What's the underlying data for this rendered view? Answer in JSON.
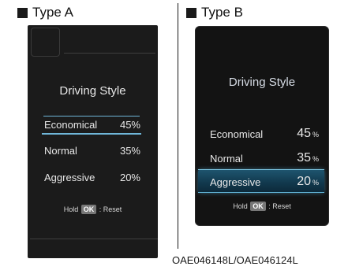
{
  "type_a": {
    "label": "Type A",
    "title": "Driving Style",
    "rows": [
      {
        "name": "Economical",
        "value": "45%"
      },
      {
        "name": "Normal",
        "value": "35%"
      },
      {
        "name": "Aggressive",
        "value": "20%"
      }
    ],
    "selected": "Economical",
    "hold_prefix": "Hold",
    "ok_label": "OK",
    "hold_suffix": ": Reset"
  },
  "type_b": {
    "label": "Type B",
    "title": "Driving Style",
    "rows": [
      {
        "name": "Economical",
        "value": "45",
        "unit": "%"
      },
      {
        "name": "Normal",
        "value": "35",
        "unit": "%"
      },
      {
        "name": "Aggressive",
        "value": "20",
        "unit": "%"
      }
    ],
    "selected": "Aggressive",
    "hold_prefix": "Hold",
    "ok_label": "OK",
    "hold_suffix": ": Reset"
  },
  "caption": "OAE046148L/OAE046124L",
  "colors": {
    "highlight": "#6fb6d8",
    "panel_bg": "#1b1b1b",
    "selection_bg": "#1f5670"
  }
}
